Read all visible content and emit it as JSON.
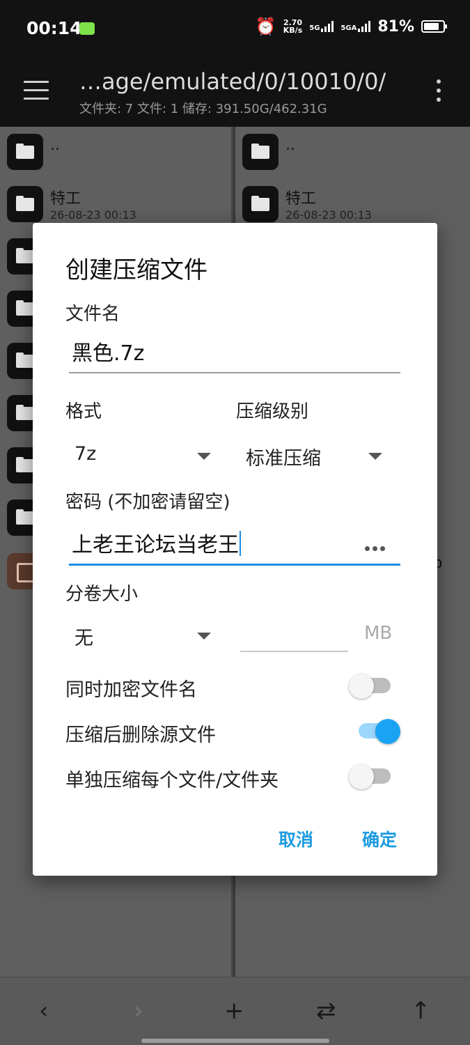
{
  "status_bar": {
    "time": "00:14",
    "speed_value": "2.70",
    "speed_unit": "KB/s",
    "net1": "5G",
    "net2": "5GA",
    "battery": "81%",
    "battery_level": 0.81
  },
  "app_bar": {
    "path": "…age/emulated/0/10010/0/",
    "summary": "文件夹: 7  文件: 1  储存: 391.50G/462.31G"
  },
  "left_pane": {
    "up": "..",
    "items": [
      {
        "name": "特工",
        "meta": "26-08-23 00:13"
      }
    ]
  },
  "right_pane": {
    "up": "..",
    "items": [
      {
        "name": "特工",
        "meta": "26-08-23 00:13"
      }
    ],
    "partial_text": "o"
  },
  "dialog": {
    "title": "创建压缩文件",
    "filename_label": "文件名",
    "filename_value": "黑色.7z",
    "format_label": "格式",
    "format_value": "7z",
    "level_label": "压缩级别",
    "level_value": "标准压缩",
    "password_label": "密码 (不加密请留空)",
    "password_value": "上老王论坛当老王",
    "volume_label": "分卷大小",
    "volume_value": "无",
    "volume_unit": "MB",
    "toggles": [
      {
        "label": "同时加密文件名",
        "on": false
      },
      {
        "label": "压缩后删除源文件",
        "on": true
      },
      {
        "label": "单独压缩每个文件/文件夹",
        "on": false
      }
    ],
    "cancel": "取消",
    "ok": "确定"
  },
  "bottom_bar": {
    "back": "‹",
    "forward": "›",
    "add": "+",
    "swap": "⇄",
    "up": "↑"
  }
}
